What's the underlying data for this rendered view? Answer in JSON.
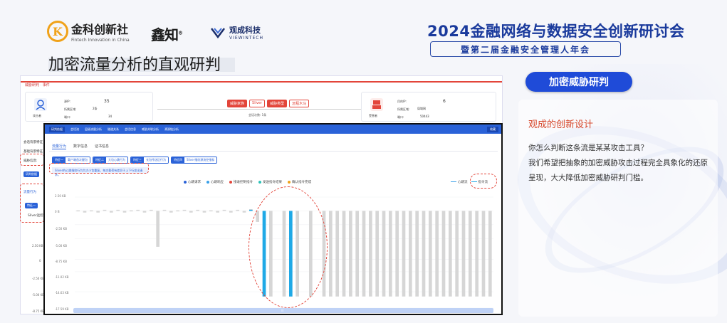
{
  "header": {
    "logo1_name": "金科创新社",
    "logo1_tagline": "Fintech Innovation in China",
    "logo2_name": "鑫知",
    "logo2_mark": "®",
    "logo3_name": "观成科技",
    "logo3_tagline": "VIEWINTECH",
    "conference_title": "2024金融网络与数据安全创新研讨会",
    "conference_subtitle": "暨第二届金融安全管理人年会"
  },
  "page_title": "加密流量分析的直观研判",
  "right_panel": {
    "pill_label": "加密威胁研判",
    "heading": "观成的创新设计",
    "line1": "你怎么判断这条流是某某攻击工具？",
    "line2": "我们希望把抽象的加密威胁攻击过程完全具象化的还原呈现，大大降低加密威胁研判门槛。"
  },
  "back_screen": {
    "breadcrumb": "威胁研判 · 事件",
    "src_labels": [
      "源IP:",
      "所属区域:",
      "端口:"
    ],
    "src_values": [
      "35",
      "2条",
      "34"
    ],
    "src_name": "攻击者",
    "badges": [
      "威胁家族",
      "Sliver",
      "威胁类型",
      "远程木马"
    ],
    "mid_text": "会话次数: 1条",
    "dst_labels": [
      "目的IP:",
      "所属区域:",
      "端口:"
    ],
    "dst_values": [
      "6",
      "局域网",
      "50443"
    ],
    "dst_name": "受害者",
    "side_labels": [
      "会话背景特征",
      "基础背景特征",
      "威胁信息:",
      "研判依据",
      "流量行为",
      "特征一",
      "Sliver远控指令"
    ],
    "y_labels": [
      "2.50 KB",
      "0",
      "-2.50 KB",
      "-5.00 KB",
      "-8.75 KB"
    ]
  },
  "front_screen": {
    "nav": [
      "研判依据",
      "会话流",
      "层级流量分析",
      "隧道关系",
      "会话信息",
      "威胁关联分析",
      "溯源链分析"
    ],
    "nav_right": "收藏",
    "tabs": [
      "流量行为",
      "数字信息",
      "证书信息"
    ],
    "filters": [
      {
        "k": "特征一",
        "v": "载户端首次握包"
      },
      {
        "k": "特征二",
        "v": "大包心跳行为"
      },
      {
        "k": "特征三",
        "v": "长包传送后行为"
      },
      {
        "k": "特征四",
        "v": "Sliver指纹源流控指标"
      }
    ],
    "notice": "Sliver的心跳指纹行为为大小包重复，每次载荷有差异于上下行发出请求。",
    "legend": [
      {
        "label": "心跳请求",
        "color": "#2a62d8"
      },
      {
        "label": "心跳响应",
        "color": "#3aa0e8"
      },
      {
        "label": "接收控制指令",
        "color": "#e3453a"
      },
      {
        "label": "发送指令结果",
        "color": "#2ec2b8"
      },
      {
        "label": "确认指令完成",
        "color": "#f0a21a"
      }
    ],
    "legend_right": [
      {
        "label": "心跳流",
        "color": "#3aa0e8"
      },
      {
        "label": "指令流",
        "color": "#1fa9e6"
      }
    ],
    "y_ticks": [
      "2.50 KB",
      "0 B",
      "-2.50 KB",
      "-5.00 KB",
      "-8.75 KB",
      "-11.02 KB",
      "-14.63 KB",
      "-17.59 KB"
    ]
  },
  "chart_data": {
    "type": "bar",
    "title": "",
    "xlabel": "",
    "ylabel": "",
    "ylim": [
      -17.59,
      2.5
    ],
    "series": [
      {
        "name": "心跳流",
        "color": "#d6d6d6",
        "values": [
          0.1,
          -0.3,
          0.1,
          -0.3,
          0.2,
          -0.3,
          0.2,
          -0.3,
          0.1,
          0.2,
          -0.3,
          0.2,
          -6.5,
          0.2,
          -0.3,
          0.1,
          0.2,
          -0.3,
          0.2,
          -0.3,
          0.1,
          -0.3,
          0.2,
          -0.3,
          0.2,
          -0.3,
          0.3,
          -2.0,
          0,
          -15.5,
          0,
          -15.5,
          0,
          -15.5,
          0,
          -15.5,
          0,
          -15.5,
          -15.5,
          -15.5,
          -15.5,
          -15.5,
          -15.5,
          -15.5,
          -15.5,
          -15.5,
          -15.5,
          -15.5,
          -15.5,
          -15.5,
          -15.5,
          -15.5,
          -15.5,
          -15.5,
          -15.5,
          -15.5,
          -15.5,
          -15.5,
          -15.5,
          -15.5,
          -15.5,
          -15.5,
          -15.5
        ]
      },
      {
        "name": "指令流",
        "color": "#1fa9e6",
        "values": [
          0,
          0,
          0,
          0,
          0,
          0,
          0,
          0,
          0,
          0,
          0,
          0,
          0,
          0,
          0,
          0,
          0,
          0,
          0,
          0,
          0,
          0,
          0,
          0,
          0,
          0,
          0.2,
          0,
          -15.5,
          0,
          0,
          0,
          -15.5,
          0,
          0,
          0,
          0,
          0,
          0,
          0,
          0,
          0,
          0,
          0,
          0,
          0,
          0,
          0,
          0,
          0,
          0,
          0,
          0,
          0,
          0,
          0,
          0,
          0,
          0,
          0,
          0,
          0,
          0
        ]
      }
    ]
  },
  "scrollbar_label": "|||"
}
